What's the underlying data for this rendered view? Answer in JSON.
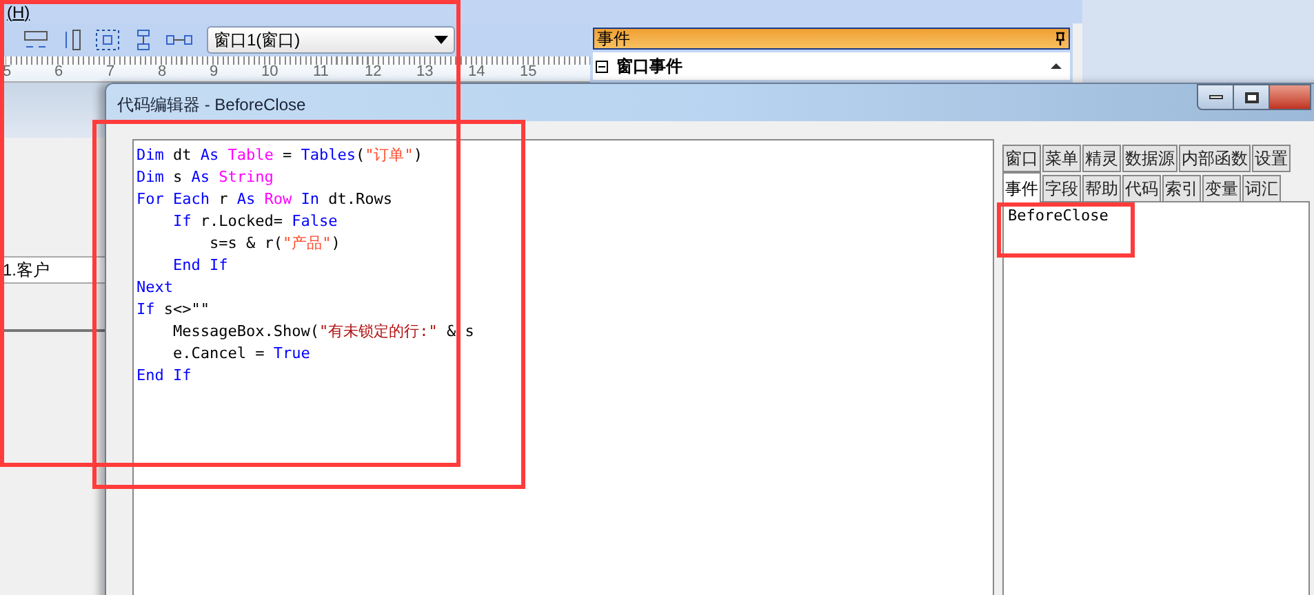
{
  "menu_bar": {
    "items": [
      "(H)"
    ]
  },
  "toolbar": {
    "window_select": "窗口1(窗口)"
  },
  "ruler": {
    "labels": [
      "5",
      "6",
      "7",
      "8",
      "9",
      "10",
      "11",
      "12",
      "13",
      "14",
      "15"
    ]
  },
  "event_panel": {
    "title": "事件",
    "section": {
      "label": "窗口事件",
      "expanded": true
    }
  },
  "background_list": {
    "rows": [
      "1.客户"
    ]
  },
  "code_editor": {
    "title": "代码编辑器 - BeforeClose",
    "lines": [
      [
        {
          "kind": "kw",
          "text": "Dim"
        },
        {
          "kind": "plain",
          "text": " dt "
        },
        {
          "kind": "kw",
          "text": "As "
        },
        {
          "kind": "type",
          "text": "Table"
        },
        {
          "kind": "plain",
          "text": " = "
        },
        {
          "kind": "kw",
          "text": "Tables"
        },
        {
          "kind": "plain",
          "text": "("
        },
        {
          "kind": "str",
          "text": "\"订单\""
        },
        {
          "kind": "plain",
          "text": ")"
        }
      ],
      [
        {
          "kind": "kw",
          "text": "Dim"
        },
        {
          "kind": "plain",
          "text": " s "
        },
        {
          "kind": "kw",
          "text": "As "
        },
        {
          "kind": "type",
          "text": "String"
        }
      ],
      [
        {
          "kind": "kw",
          "text": "For Each"
        },
        {
          "kind": "plain",
          "text": " r "
        },
        {
          "kind": "kw",
          "text": "As "
        },
        {
          "kind": "type",
          "text": "Row"
        },
        {
          "kind": "kw",
          "text": " In"
        },
        {
          "kind": "plain",
          "text": " dt.Rows"
        }
      ],
      [
        {
          "kind": "kw",
          "text": "    If"
        },
        {
          "kind": "plain",
          "text": " r.Locked= "
        },
        {
          "kind": "kw",
          "text": "False"
        }
      ],
      [
        {
          "kind": "plain",
          "text": "        s=s & r("
        },
        {
          "kind": "str",
          "text": "\"产品\""
        },
        {
          "kind": "plain",
          "text": ")"
        }
      ],
      [
        {
          "kind": "kw",
          "text": "    End If"
        }
      ],
      [
        {
          "kind": "kw",
          "text": "Next"
        }
      ],
      [
        {
          "kind": "kw",
          "text": "If"
        },
        {
          "kind": "plain",
          "text": " s<>\"\""
        }
      ],
      [
        {
          "kind": "plain",
          "text": "    MessageBox.Show("
        },
        {
          "kind": "msg",
          "text": "\"有未锁定的行:\""
        },
        {
          "kind": "plain",
          "text": " & s"
        }
      ],
      [
        {
          "kind": "plain",
          "text": "    e.Cancel = "
        },
        {
          "kind": "kw",
          "text": "True"
        }
      ],
      [
        {
          "kind": "kw",
          "text": "End If"
        }
      ]
    ],
    "tab_rows": [
      [
        {
          "label": "窗口",
          "selected": false
        },
        {
          "label": "菜单",
          "selected": false
        },
        {
          "label": "精灵",
          "selected": false
        },
        {
          "label": "数据源",
          "selected": false
        },
        {
          "label": "内部函数",
          "selected": false
        },
        {
          "label": "设置",
          "selected": false
        }
      ],
      [
        {
          "label": "事件",
          "selected": true
        },
        {
          "label": "字段",
          "selected": false
        },
        {
          "label": "帮助",
          "selected": false
        },
        {
          "label": "代码",
          "selected": false
        },
        {
          "label": "索引",
          "selected": false
        },
        {
          "label": "变量",
          "selected": false
        },
        {
          "label": "词汇",
          "selected": false
        }
      ]
    ],
    "list_items": [
      "BeforeClose"
    ]
  }
}
